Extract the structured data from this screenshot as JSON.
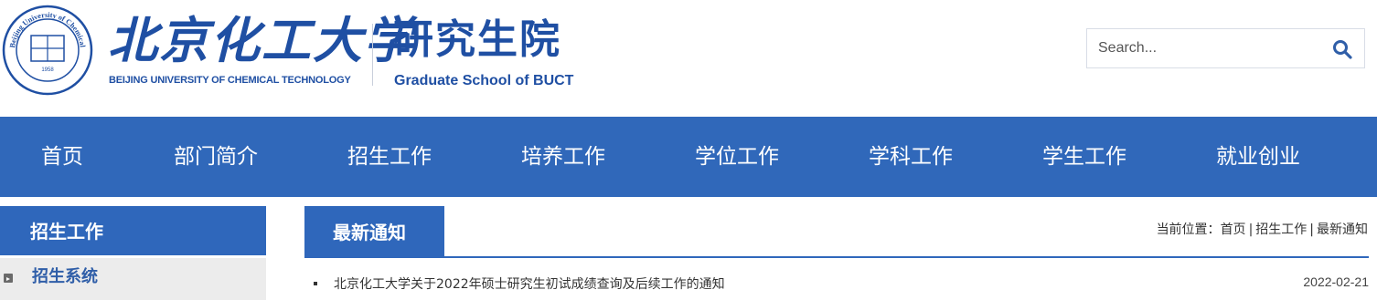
{
  "header": {
    "brand_cn": "北京化工大学",
    "brand_en": "BEIJING UNIVERSITY OF CHEMICAL TECHNOLOGY",
    "school_cn": "研究生院",
    "school_en": "Graduate School of BUCT",
    "seal_icon": "university-seal-icon",
    "seal_text": "Beijing University of Chemical Technology",
    "seal_year": "1958"
  },
  "search": {
    "placeholder": "Search...",
    "value": "",
    "icon": "search-icon"
  },
  "nav": {
    "items": [
      {
        "label": "首页"
      },
      {
        "label": "部门简介"
      },
      {
        "label": "招生工作"
      },
      {
        "label": "培养工作"
      },
      {
        "label": "学位工作"
      },
      {
        "label": "学科工作"
      },
      {
        "label": "学生工作"
      },
      {
        "label": "就业创业"
      }
    ]
  },
  "sidebar": {
    "title": "招生工作",
    "items": [
      {
        "label": "招生系统",
        "icon": "expand-bullet-icon"
      }
    ]
  },
  "main": {
    "tab": "最新通知",
    "breadcrumb": {
      "prefix": "当前位置：",
      "items": [
        "首页",
        "招生工作",
        "最新通知"
      ]
    },
    "news": [
      {
        "title": "北京化工大学关于2022年硕士研究生初试成绩查询及后续工作的通知",
        "date": "2022-02-21"
      }
    ]
  },
  "colors": {
    "brand_blue": "#1f4fa3",
    "nav_blue": "#3068ba",
    "panel_blue": "#2f67bb"
  }
}
